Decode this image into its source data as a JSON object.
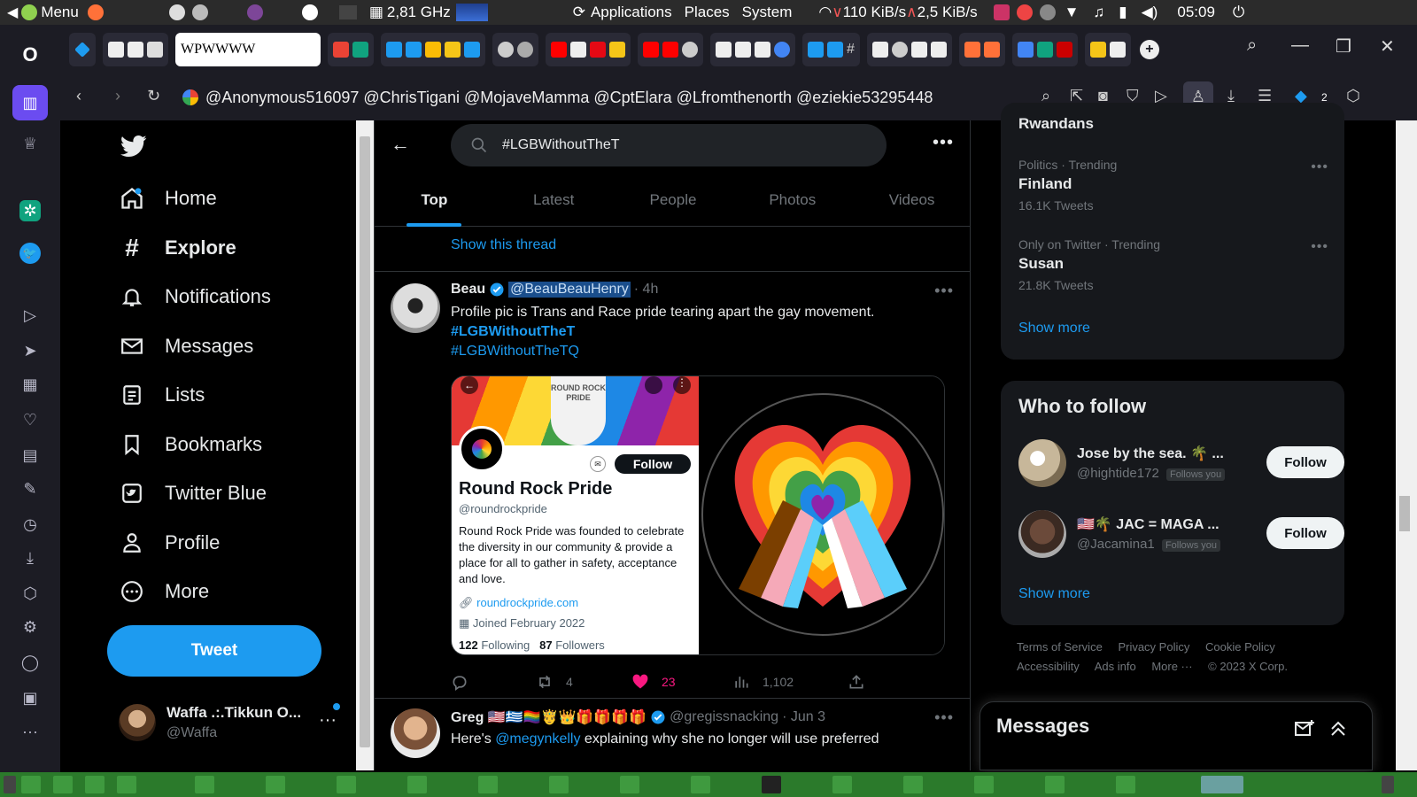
{
  "system_panel": {
    "menu_label": "Menu",
    "cpu_freq": "2,81 GHz",
    "applications": "Applications",
    "places": "Places",
    "system": "System",
    "net_down": "110 KiB/s",
    "net_up": "2,5 KiB/s",
    "clock": "05:09"
  },
  "browser": {
    "url": "@Anonymous516097 @ChrisTigani @MojaveMamma @CptElara @Lfromthenorth @eziekie53295448",
    "tab_badge": "2"
  },
  "left_nav": {
    "items": [
      {
        "label": "Home",
        "icon": "home-icon"
      },
      {
        "label": "Explore",
        "icon": "hashtag-icon"
      },
      {
        "label": "Notifications",
        "icon": "bell-icon"
      },
      {
        "label": "Messages",
        "icon": "envelope-icon"
      },
      {
        "label": "Lists",
        "icon": "list-icon"
      },
      {
        "label": "Bookmarks",
        "icon": "bookmark-icon"
      },
      {
        "label": "Twitter Blue",
        "icon": "twitter-blue-icon"
      },
      {
        "label": "Profile",
        "icon": "person-icon"
      },
      {
        "label": "More",
        "icon": "more-circle-icon"
      }
    ],
    "tweet_button": "Tweet",
    "account": {
      "name": "Waffa .:.Tikkun O...",
      "handle": "@Waffa"
    }
  },
  "search": {
    "query": "#LGBWithoutTheT",
    "tabs": [
      "Top",
      "Latest",
      "People",
      "Photos",
      "Videos"
    ],
    "active_tab": "Top"
  },
  "feed": {
    "show_thread": "Show this thread",
    "tweet1": {
      "name": "Beau",
      "handle": "@BeauBeauHenry",
      "time": "· 4h",
      "text": "Profile pic is Trans and Race pride tearing apart the gay movement.",
      "hashtag1": "#LGBWithoutTheT",
      "hashtag2": "#LGBWithoutTheTQ",
      "embedded_profile": {
        "follow": "Follow",
        "name": "Round Rock Pride",
        "handle": "@roundrockpride",
        "bio": "Round Rock Pride was founded to celebrate the diversity in our community & provide a place for all to gather in safety, acceptance and love.",
        "link": "roundrockpride.com",
        "joined": "Joined February 2022",
        "following_count": "122",
        "following_label": "Following",
        "followers_count": "87",
        "followers_label": "Followers",
        "banner_text": "ROUND ROCK PRIDE"
      },
      "retweets": "4",
      "likes": "23",
      "views": "1,102"
    },
    "tweet2": {
      "name": "Greg 🇺🇸🇬🇷🏳️‍🌈🤴👑🎁🎁🎁🎁",
      "handle": "@gregissnacking",
      "time": "· Jun 3",
      "text_before": "Here's ",
      "mention": "@megynkelly",
      "text_after": " explaining why she no longer will use preferred"
    }
  },
  "right_col": {
    "trend_prev": "Rwandans",
    "trends": [
      {
        "category": "Politics · Trending",
        "name": "Finland",
        "count": "16.1K Tweets"
      },
      {
        "category": "Only on Twitter · Trending",
        "name": "Susan",
        "count": "21.8K Tweets"
      }
    ],
    "show_more": "Show more",
    "who_to_follow": {
      "title": "Who to follow",
      "users": [
        {
          "name": "Jose by the sea. 🌴 ...",
          "handle": "@hightide172",
          "badge": "Follows you",
          "button": "Follow"
        },
        {
          "name": "🇺🇸🌴 JAC = MAGA ...",
          "handle": "@Jacamina1",
          "badge": "Follows you",
          "button": "Follow"
        }
      ],
      "show_more": "Show more"
    },
    "footer": [
      "Terms of Service",
      "Privacy Policy",
      "Cookie Policy",
      "Accessibility",
      "Ads info",
      "More ···",
      "© 2023 X Corp."
    ],
    "messages_title": "Messages"
  }
}
